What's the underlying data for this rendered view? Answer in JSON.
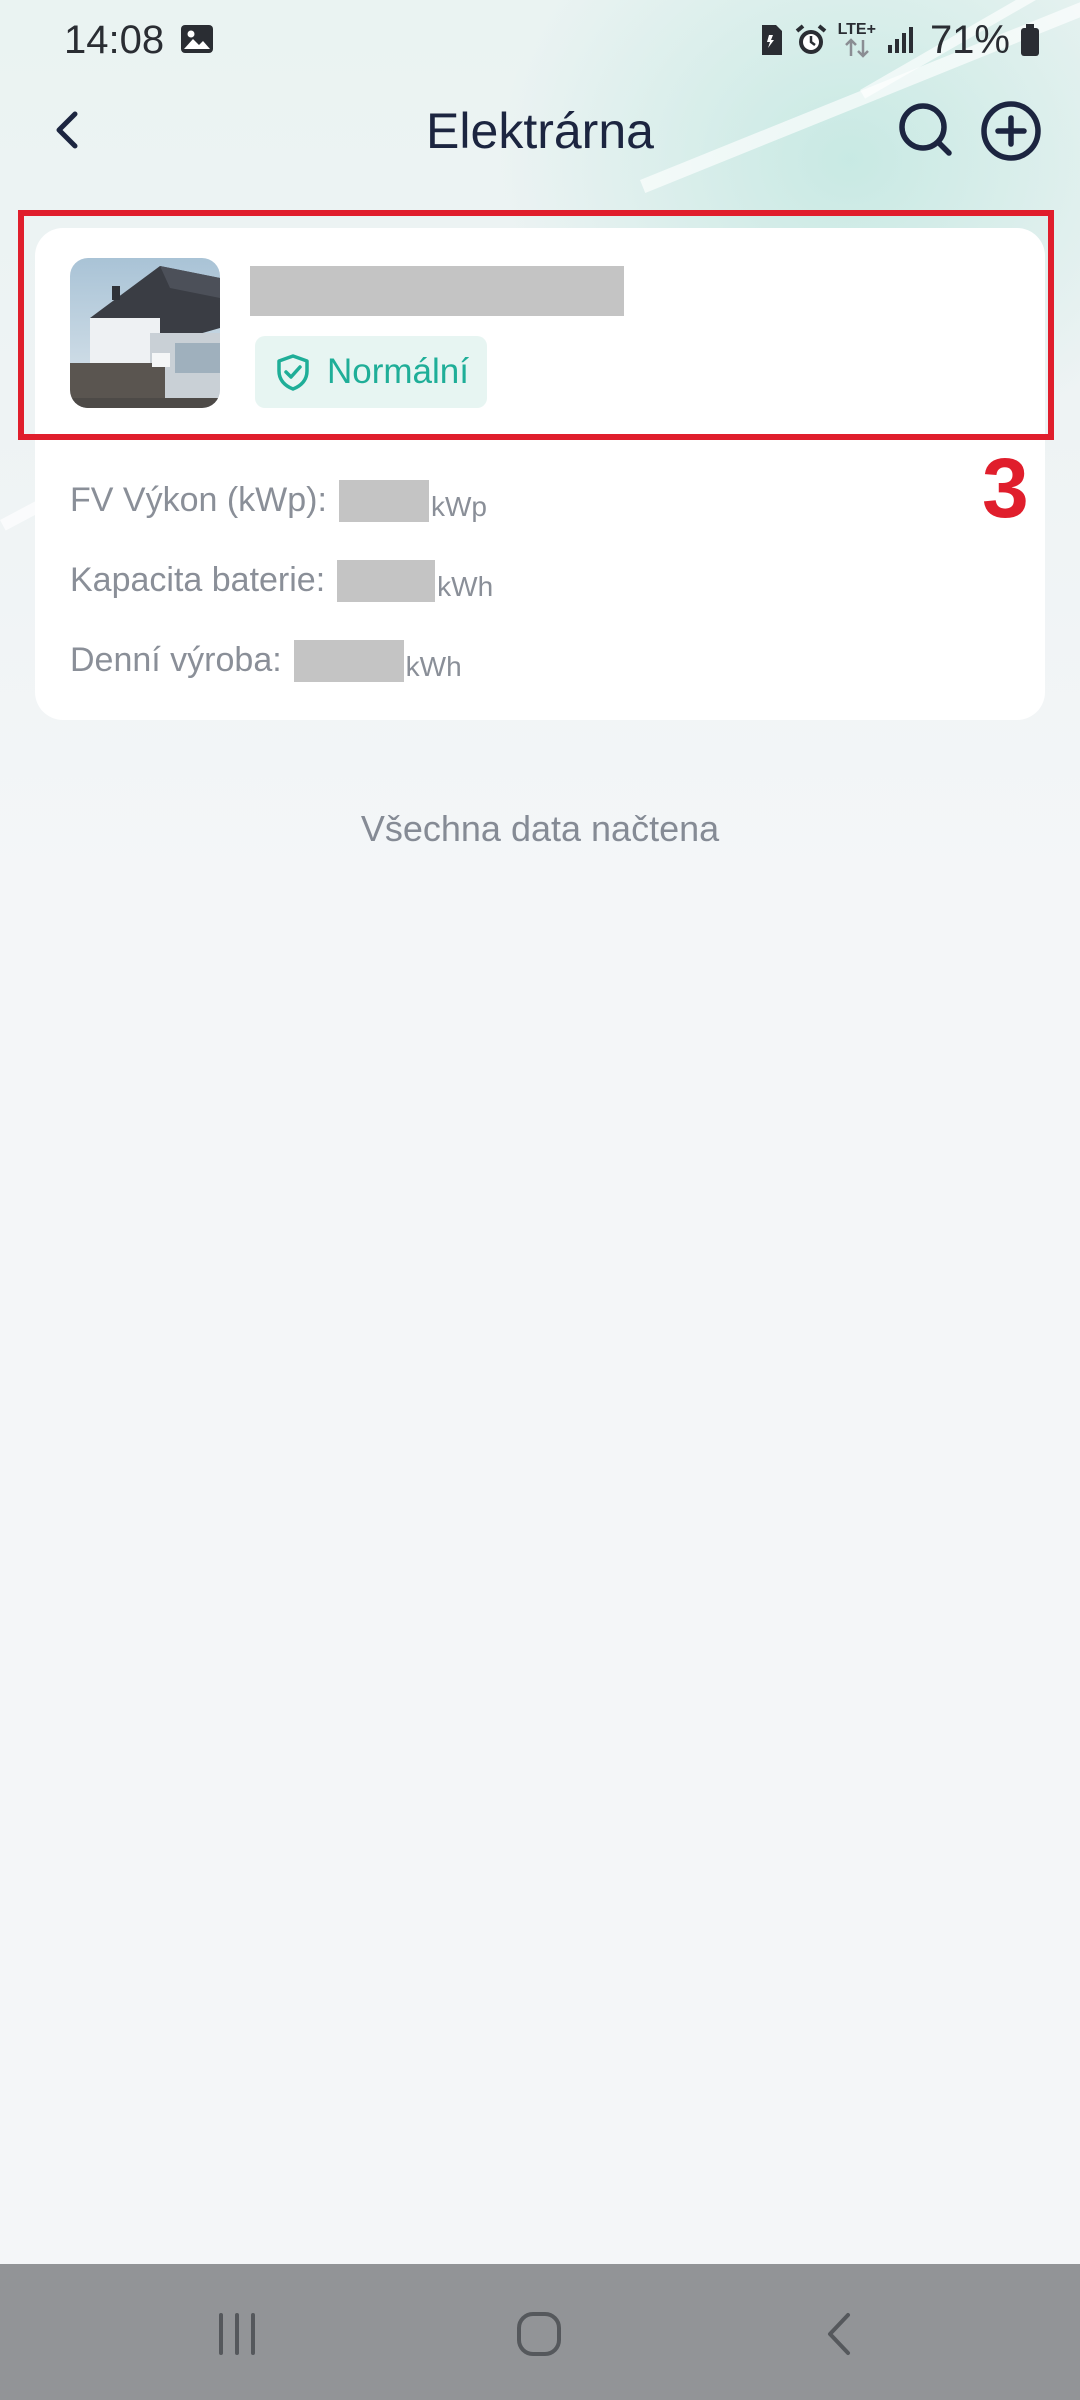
{
  "status_bar": {
    "time": "14:08",
    "network": "LTE+",
    "battery": "71%",
    "icons": [
      "gallery-icon",
      "sim-icon",
      "alarm-icon",
      "data-arrows-icon",
      "signal-icon",
      "battery-icon"
    ]
  },
  "header": {
    "title": "Elektrárna",
    "back_icon": "chevron-left-icon",
    "search_icon": "search-icon",
    "add_icon": "plus-circle-icon"
  },
  "plant": {
    "status": "Normální",
    "status_icon": "shield-check-icon",
    "fields": [
      {
        "label": "FV Výkon (kWp):",
        "unit": "kWp"
      },
      {
        "label": "Kapacita baterie:",
        "unit": "kWh"
      },
      {
        "label": "Denní výroba:",
        "unit": "kWh"
      }
    ]
  },
  "annotation": {
    "number": "3"
  },
  "footer": {
    "text": "Všechna data načtena"
  },
  "nav": {
    "icons": [
      "recent-apps-icon",
      "home-icon",
      "back-icon"
    ]
  },
  "colors": {
    "accent": "#1fae98",
    "title": "#1c2540",
    "annotation": "#e01e2c"
  }
}
